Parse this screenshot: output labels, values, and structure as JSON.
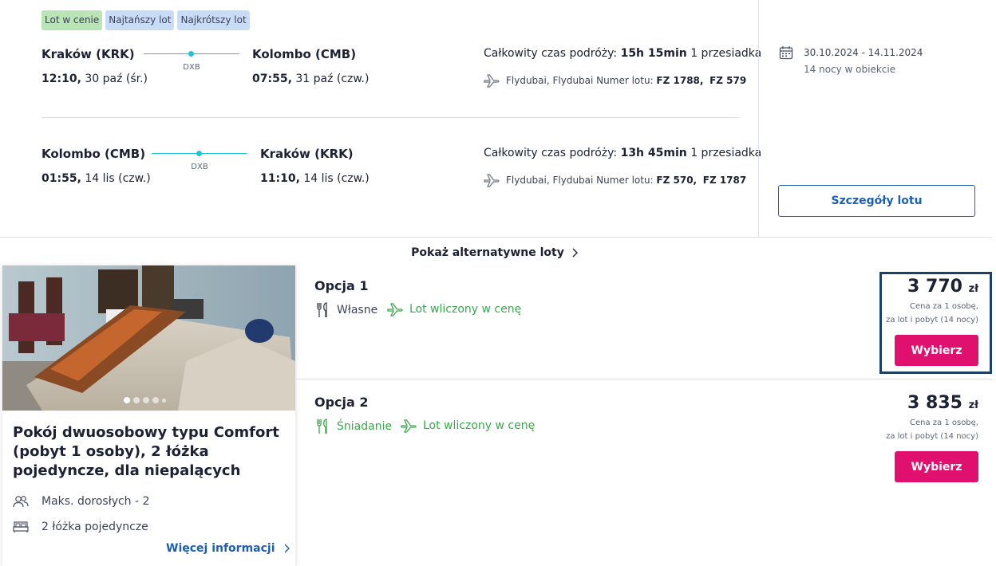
{
  "badges": [
    "Lot w cenie",
    "Najtańszy lot",
    "Najkrótszy lot"
  ],
  "colors": {
    "accent": "#e0106f",
    "link": "#1f5fb0",
    "route": "#22c3d6",
    "included": "#3aa84d"
  },
  "outbound": {
    "from_city": "Kraków (KRK)",
    "from_time": "12:10,",
    "from_date": " 30 paź (śr.)",
    "stop": "DXB",
    "to_city": "Kolombo (CMB)",
    "to_time": "07:55,",
    "to_date": " 31 paź (czw.)",
    "total_label": "Całkowity czas podróży: ",
    "total_value": "15h 15min",
    "stops": " 1 przesiadka",
    "airlines": "Flydubai,  Flydubai Numer lotu: ",
    "flight1": "FZ 1788,",
    "flight2": "FZ 579"
  },
  "inbound": {
    "from_city": "Kolombo (CMB)",
    "from_time": "01:55,",
    "from_date": " 14 lis (czw.)",
    "stop": "DXB",
    "to_city": "Kraków (KRK)",
    "to_time": "11:10,",
    "to_date": " 14 lis (czw.)",
    "total_label": "Całkowity czas podróży: ",
    "total_value": "13h 45min",
    "stops": " 1 przesiadka",
    "airlines": "Flydubai,  Flydubai Numer lotu: ",
    "flight1": "FZ 570,",
    "flight2": "FZ 1787"
  },
  "stay": {
    "dates": "30.10.2024 - 14.11.2024",
    "nights": "14 nocy w obiekcie"
  },
  "details_button": "Szczegóły lotu",
  "alt_flights": "Pokaż alternatywne loty",
  "room": {
    "title": "Pokój dwuosobowy typu Comfort (pobyt 1 osoby), 2 łóżka pojedyncze, dla niepalących",
    "max_adults": "Maks. dorosłych - 2",
    "beds": "2 łóżka pojedyncze",
    "more_info": "Więcej informacji"
  },
  "options": [
    {
      "title": "Opcja 1",
      "board": "Własne",
      "flight": "Lot wliczony w cenę",
      "price": "3 770",
      "currency": "zł",
      "note1": "Cena za 1 osobę,",
      "note2": "za lot i pobyt (14 nocy)",
      "button": "Wybierz"
    },
    {
      "title": "Opcja 2",
      "board": "Śniadanie",
      "flight": "Lot wliczony w cenę",
      "price": "3 835",
      "currency": "zł",
      "note1": "Cena za 1 osobę,",
      "note2": "za lot i pobyt (14 nocy)",
      "button": "Wybierz"
    }
  ]
}
